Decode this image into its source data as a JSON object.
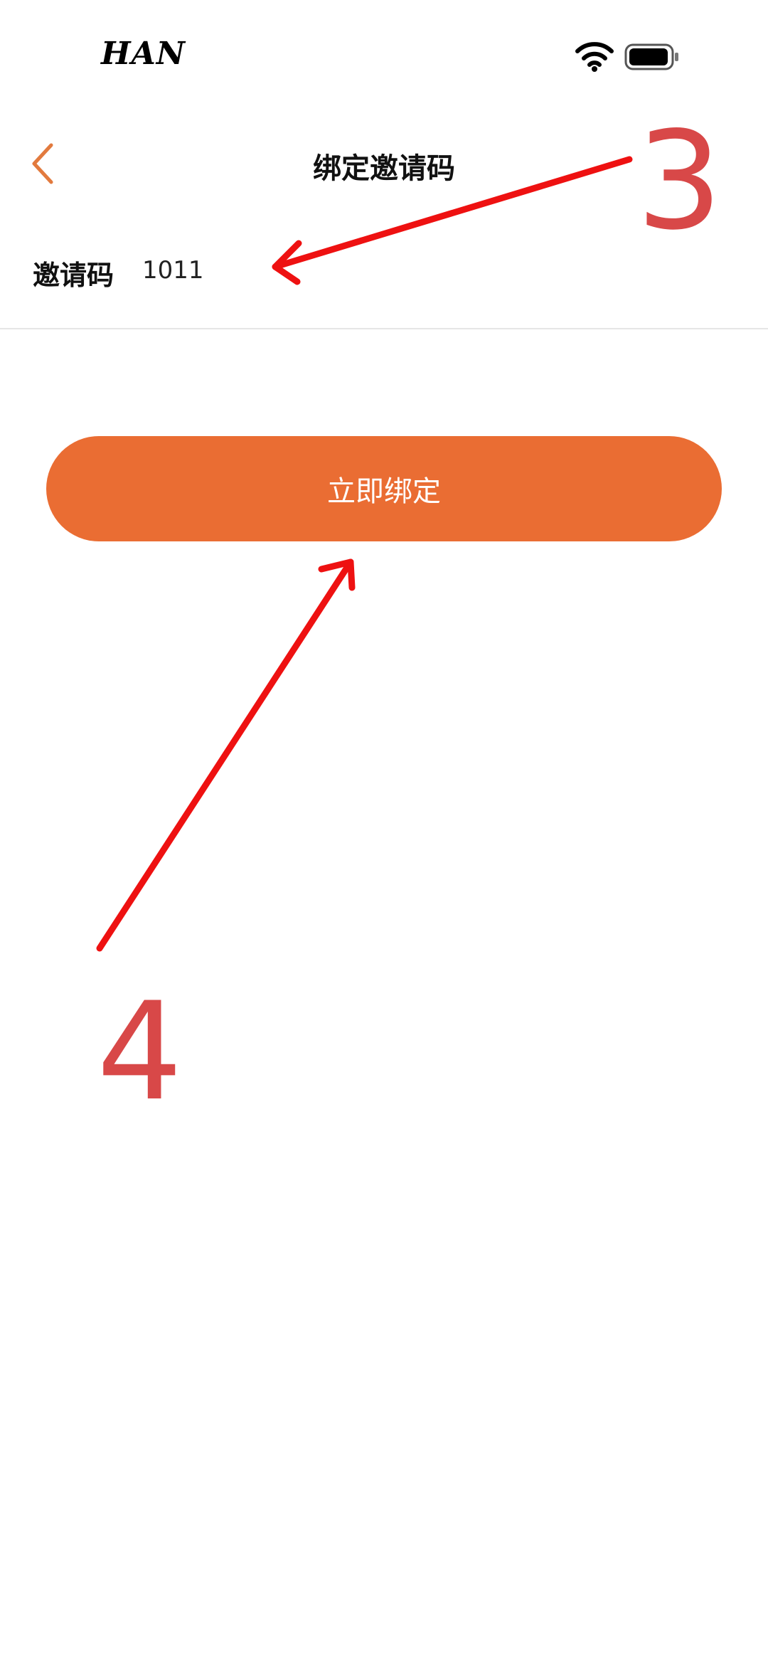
{
  "status_bar": {
    "carrier": "HAN",
    "wifi_icon": "wifi-icon",
    "battery_icon": "battery-icon"
  },
  "nav": {
    "back_icon": "chevron-left-icon",
    "title": "绑定邀请码"
  },
  "invite": {
    "label": "邀请码",
    "value": "1011"
  },
  "bind_button": {
    "label": "立即绑定"
  },
  "annotations": {
    "step_3": "3",
    "step_4": "4"
  },
  "colors": {
    "accent": "#ea6d33",
    "annotation_arrow": "#ee1111",
    "annotation_number": "#d84848",
    "divider": "#e6e6e6"
  }
}
